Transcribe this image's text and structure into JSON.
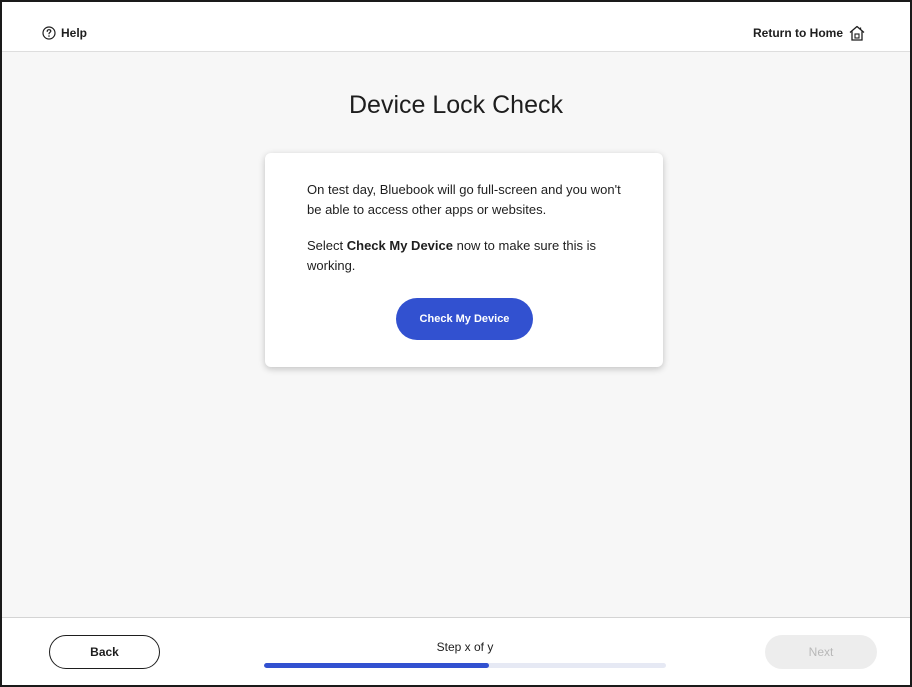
{
  "header": {
    "help_label": "Help",
    "help_icon": "question-circle-icon",
    "home_label": "Return to Home",
    "home_icon": "home-icon"
  },
  "main": {
    "title": "Device Lock Check",
    "card": {
      "paragraph1": "On test day, Bluebook will go full-screen and you won't be able to access other apps or websites.",
      "paragraph2_prefix": "Select ",
      "paragraph2_bold": "Check My Device",
      "paragraph2_suffix": " now to make sure this is working.",
      "button_label": "Check My Device"
    }
  },
  "footer": {
    "back_label": "Back",
    "step_label": "Step x of y",
    "progress_fraction": 0.56,
    "next_label": "Next",
    "next_disabled": true
  },
  "colors": {
    "accent": "#3251d0",
    "background": "#f7f7f7",
    "disabled_button": "#ededed",
    "disabled_text": "#b8b8b8"
  }
}
